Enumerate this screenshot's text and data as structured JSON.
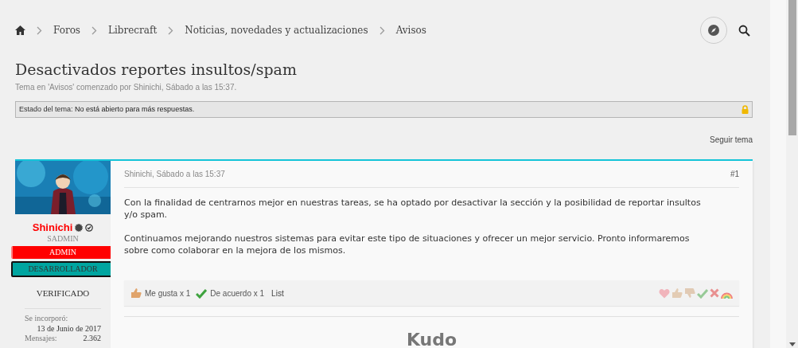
{
  "breadcrumb": [
    "Foros",
    "Librecraft",
    "Noticias, novedades y actualizaciones",
    "Avisos"
  ],
  "thread": {
    "title": "Desactivados reportes insultos/spam",
    "meta": "Tema en 'Avisos' comenzado por Shinichi, Sábado a las 15:37.",
    "status_label": "Estado del tema:",
    "status_value": "No está abierto para más respuestas.",
    "locked": true,
    "follow": "Seguir tema"
  },
  "post": {
    "author": {
      "name": "Shinichi",
      "title": "SADMIN",
      "banners": [
        {
          "label": "ADMIN",
          "color": "#ff0000",
          "kind": "banner"
        },
        {
          "label": "DESARROLLADOR",
          "color": "#00a5a0",
          "kind": "banner"
        },
        {
          "label": "VERIFICADO",
          "kind": "plain"
        }
      ],
      "stats": [
        {
          "label": "Se incorporó:",
          "value": "13 de Junio de 2017",
          "kind": "block"
        },
        {
          "label": "Mensajes:",
          "value": "2.362",
          "kind": "inline"
        }
      ]
    },
    "date": "Shinichi, Sábado a las 15:37",
    "number": "#1",
    "paragraphs": [
      "Con la finalidad de centrarnos mejor en nuestras tareas, se ha optado por desactivar la sección y la posibilidad de reportar insultos y/o spam.",
      "Continuamos mejorando nuestros sistemas para evitar este tipo de situaciones y ofrecer un mejor servicio. Pronto informaremos sobre como colaborar en la mejora de los mismos."
    ],
    "reactions": [
      {
        "kind": "like",
        "label": "Me gusta x 1"
      },
      {
        "kind": "agree",
        "label": "De acuerdo x 1"
      }
    ],
    "list_link": "List",
    "signature": "Kudo"
  }
}
